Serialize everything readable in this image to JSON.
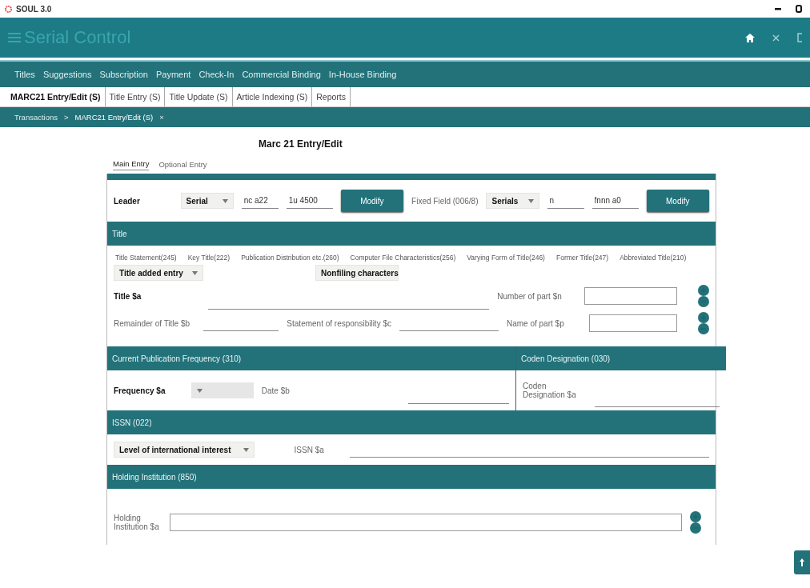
{
  "window": {
    "title": "SOUL 3.0"
  },
  "header": {
    "title": "Serial Control"
  },
  "menu": [
    "Titles",
    "Suggestions",
    "Subscription",
    "Payment",
    "Check-In",
    "Commercial Binding",
    "In-House Binding"
  ],
  "tabs": [
    {
      "label": "MARC21 Entry/Edit (S)",
      "selected": true
    },
    {
      "label": "Title Entry (S)",
      "selected": false
    },
    {
      "label": "Title Update (S)",
      "selected": false
    },
    {
      "label": "Article Indexing (S)",
      "selected": false
    },
    {
      "label": "Reports",
      "selected": false
    }
  ],
  "breadcrumb": {
    "items": [
      "Transactions",
      "MARC21 Entry/Edit (S)"
    ],
    "separator": ">",
    "close": "×"
  },
  "form": {
    "heading": "Marc 21 Entry/Edit",
    "entry_tabs": [
      {
        "label": "Main Entry",
        "selected": true
      },
      {
        "label": "Optional Entry",
        "selected": false
      }
    ],
    "leader": {
      "label": "Leader",
      "select": "Serial",
      "inputs": [
        "nc a22",
        "1u 4500"
      ],
      "button": "Modify"
    },
    "fixed_field": {
      "label": "Fixed Field (006/8)",
      "select": "Serials",
      "inputs": [
        "n",
        "fnnn a0"
      ],
      "button": "Modify"
    },
    "title": {
      "header": "Title",
      "tabs": [
        "Title Statement(245)",
        "Key Title(222)",
        "Publication Distribution etc.(260)",
        "Computer File Characteristics(256)",
        "Varying Form of Title(246)",
        "Former Title(247)",
        "Abbreviated Title(210)"
      ],
      "selects": [
        "Title added entry",
        "Nonfiling characters"
      ],
      "title_a": {
        "text": "Title $a",
        "required": true
      },
      "number_n": {
        "text": "Number of part $n",
        "required": false
      },
      "remainder_b": {
        "text": "Remainder of Title $b",
        "required": false
      },
      "responsibility_c": {
        "text": "Statement of responsibility $c",
        "required": false
      },
      "name_p": {
        "text": "Name of part $p",
        "required": false
      }
    },
    "frequency": {
      "header": "Current Publication Frequency (310)",
      "label": {
        "text": "Frequency $a",
        "required": true
      },
      "select_disabled": true,
      "date_label": {
        "text": "Date $b",
        "required": false
      }
    },
    "coden": {
      "header": "Coden Designation (030)",
      "label": {
        "text": "Coden Designation $a",
        "required": false
      }
    },
    "issn": {
      "header": "ISSN (022)",
      "select": "Level of international interest",
      "label": {
        "text": "ISSN $a",
        "required": false
      }
    },
    "holding": {
      "header": "Holding Institution (850)",
      "label": {
        "text": "Holding Institution $a",
        "required": false
      }
    }
  }
}
